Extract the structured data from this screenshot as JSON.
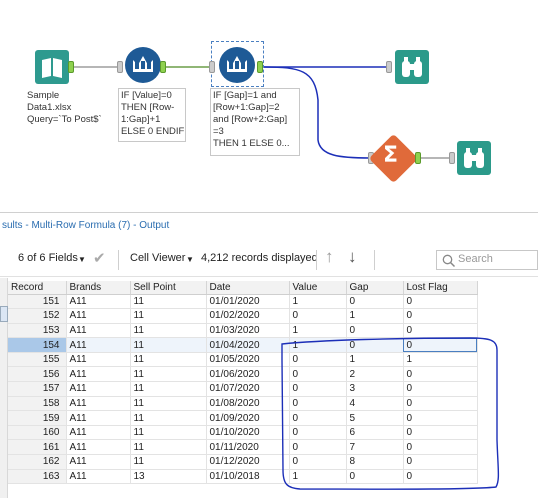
{
  "workflow": {
    "input_annotation": "Sample\nData1.xlsx\nQuery=`To Post$`",
    "formula1_annotation": "IF [Value]=0\nTHEN [Row-\n1:Gap]+1\nELSE 0 ENDIF",
    "formula2_annotation": "IF [Gap]=1 and\n[Row+1:Gap]=2\nand [Row+2:Gap]\n=3\nTHEN 1 ELSE 0..."
  },
  "results": {
    "title": "sults - Multi-Row Formula (7) - Output",
    "fields_label": "6 of 6 Fields",
    "viewer_label": "Cell Viewer",
    "records_label": "4,212 records displayed",
    "search_placeholder": "Search"
  },
  "table": {
    "columns": [
      "Record",
      "Brands",
      "Sell Point",
      "Date",
      "Value",
      "Gap",
      "Lost Flag"
    ],
    "rows": [
      [
        "151",
        "A11",
        "11",
        "01/01/2020",
        "1",
        "0",
        "0"
      ],
      [
        "152",
        "A11",
        "11",
        "01/02/2020",
        "0",
        "1",
        "0"
      ],
      [
        "153",
        "A11",
        "11",
        "01/03/2020",
        "1",
        "0",
        "0"
      ],
      [
        "154",
        "A11",
        "11",
        "01/04/2020",
        "1",
        "0",
        "0"
      ],
      [
        "155",
        "A11",
        "11",
        "01/05/2020",
        "0",
        "1",
        "1"
      ],
      [
        "156",
        "A11",
        "11",
        "01/06/2020",
        "0",
        "2",
        "0"
      ],
      [
        "157",
        "A11",
        "11",
        "01/07/2020",
        "0",
        "3",
        "0"
      ],
      [
        "158",
        "A11",
        "11",
        "01/08/2020",
        "0",
        "4",
        "0"
      ],
      [
        "159",
        "A11",
        "11",
        "01/09/2020",
        "0",
        "5",
        "0"
      ],
      [
        "160",
        "A11",
        "11",
        "01/10/2020",
        "0",
        "6",
        "0"
      ],
      [
        "161",
        "A11",
        "11",
        "01/11/2020",
        "0",
        "7",
        "0"
      ],
      [
        "162",
        "A11",
        "11",
        "01/12/2020",
        "0",
        "8",
        "0"
      ],
      [
        "163",
        "A11",
        "13",
        "01/10/2018",
        "1",
        "0",
        "0"
      ]
    ]
  },
  "colors": {
    "input_tool": "#2e9a8f",
    "formula_tool": "#1e5a96",
    "summarize_tool": "#e06a3a",
    "browse_tool": "#2b9a8a",
    "annotation_ink": "#1c2fb8"
  }
}
